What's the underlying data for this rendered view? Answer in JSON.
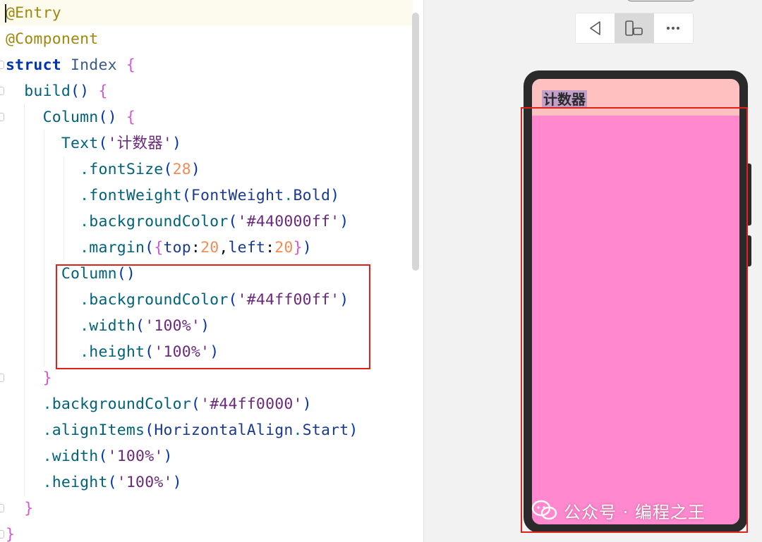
{
  "editor": {
    "lines": [
      [
        {
          "t": "@Entry",
          "c": "t-ann"
        }
      ],
      [
        {
          "t": "@Component",
          "c": "t-ann"
        }
      ],
      [
        {
          "t": "struct",
          "c": "t-kw"
        },
        {
          "t": " Index ",
          "c": "t-struct"
        },
        {
          "t": "{",
          "c": "t-brace"
        }
      ],
      [
        {
          "t": "  build",
          "c": "t-call"
        },
        {
          "t": "()",
          "c": "t-paren"
        },
        {
          "t": " {",
          "c": "t-brace"
        }
      ],
      [
        {
          "t": "    Column",
          "c": "t-call"
        },
        {
          "t": "()",
          "c": "t-paren"
        },
        {
          "t": " {",
          "c": "t-brace"
        }
      ],
      [
        {
          "t": "      Text",
          "c": "t-call"
        },
        {
          "t": "(",
          "c": "t-paren"
        },
        {
          "t": "'计数器'",
          "c": "t-strp"
        },
        {
          "t": ")",
          "c": "t-paren"
        }
      ],
      [
        {
          "t": "        .",
          "c": "t-dot"
        },
        {
          "t": "fontSize",
          "c": "t-meth"
        },
        {
          "t": "(",
          "c": "t-paren"
        },
        {
          "t": "28",
          "c": "t-num"
        },
        {
          "t": ")",
          "c": "t-paren"
        }
      ],
      [
        {
          "t": "        .",
          "c": "t-dot"
        },
        {
          "t": "fontWeight",
          "c": "t-meth"
        },
        {
          "t": "(",
          "c": "t-paren"
        },
        {
          "t": "FontWeight",
          "c": "t-kind"
        },
        {
          "t": ".",
          "c": "t-dot"
        },
        {
          "t": "Bold",
          "c": "t-kind"
        },
        {
          "t": ")",
          "c": "t-paren"
        }
      ],
      [
        {
          "t": "        .",
          "c": "t-dot"
        },
        {
          "t": "backgroundColor",
          "c": "t-meth"
        },
        {
          "t": "(",
          "c": "t-paren"
        },
        {
          "t": "'#440000ff'",
          "c": "t-strp"
        },
        {
          "t": ")",
          "c": "t-paren"
        }
      ],
      [
        {
          "t": "        .",
          "c": "t-dot"
        },
        {
          "t": "margin",
          "c": "t-meth"
        },
        {
          "t": "(",
          "c": "t-paren"
        },
        {
          "t": "{",
          "c": "t-brace"
        },
        {
          "t": "top",
          "c": "t-kind"
        },
        {
          "t": ":",
          "c": "t-plain"
        },
        {
          "t": "20",
          "c": "t-num"
        },
        {
          "t": ",",
          "c": "t-plain"
        },
        {
          "t": "left",
          "c": "t-kind"
        },
        {
          "t": ":",
          "c": "t-plain"
        },
        {
          "t": "20",
          "c": "t-num"
        },
        {
          "t": "}",
          "c": "t-brace"
        },
        {
          "t": ")",
          "c": "t-paren"
        }
      ],
      [
        {
          "t": "      Column",
          "c": "t-call"
        },
        {
          "t": "()",
          "c": "t-paren"
        }
      ],
      [
        {
          "t": "        .",
          "c": "t-dot"
        },
        {
          "t": "backgroundColor",
          "c": "t-meth"
        },
        {
          "t": "(",
          "c": "t-paren"
        },
        {
          "t": "'#44ff00ff'",
          "c": "t-strp"
        },
        {
          "t": ")",
          "c": "t-paren"
        }
      ],
      [
        {
          "t": "        .",
          "c": "t-dot"
        },
        {
          "t": "width",
          "c": "t-meth"
        },
        {
          "t": "(",
          "c": "t-paren"
        },
        {
          "t": "'100%'",
          "c": "t-strp"
        },
        {
          "t": ")",
          "c": "t-paren"
        }
      ],
      [
        {
          "t": "        .",
          "c": "t-dot"
        },
        {
          "t": "height",
          "c": "t-meth"
        },
        {
          "t": "(",
          "c": "t-paren"
        },
        {
          "t": "'100%'",
          "c": "t-strp"
        },
        {
          "t": ")",
          "c": "t-paren"
        }
      ],
      [
        {
          "t": "    }",
          "c": "t-brace"
        }
      ],
      [
        {
          "t": "    .",
          "c": "t-dot"
        },
        {
          "t": "backgroundColor",
          "c": "t-meth"
        },
        {
          "t": "(",
          "c": "t-paren"
        },
        {
          "t": "'#44ff0000'",
          "c": "t-strp"
        },
        {
          "t": ")",
          "c": "t-paren"
        }
      ],
      [
        {
          "t": "    .",
          "c": "t-dot"
        },
        {
          "t": "alignItems",
          "c": "t-meth"
        },
        {
          "t": "(",
          "c": "t-paren"
        },
        {
          "t": "HorizontalAlign",
          "c": "t-kind"
        },
        {
          "t": ".",
          "c": "t-dot"
        },
        {
          "t": "Start",
          "c": "t-kind"
        },
        {
          "t": ")",
          "c": "t-paren"
        }
      ],
      [
        {
          "t": "    .",
          "c": "t-dot"
        },
        {
          "t": "width",
          "c": "t-meth"
        },
        {
          "t": "(",
          "c": "t-paren"
        },
        {
          "t": "'100%'",
          "c": "t-strp"
        },
        {
          "t": ")",
          "c": "t-paren"
        }
      ],
      [
        {
          "t": "    .",
          "c": "t-dot"
        },
        {
          "t": "height",
          "c": "t-meth"
        },
        {
          "t": "(",
          "c": "t-paren"
        },
        {
          "t": "'100%'",
          "c": "t-strp"
        },
        {
          "t": ")",
          "c": "t-paren"
        }
      ],
      [
        {
          "t": "  }",
          "c": "t-brace"
        }
      ],
      [
        {
          "t": "}",
          "c": "t-brace"
        }
      ]
    ]
  },
  "previewer": {
    "toolbar": {
      "back_icon": "back-triangle-icon",
      "device_icon": "device-rotate-icon",
      "more_icon": "more-dots-icon"
    },
    "screen_text": "计数器"
  },
  "watermark": {
    "text": "公众号 · 编程之王",
    "icon": "wechat-icon"
  },
  "colors": {
    "highlight": "#e0201a",
    "screen_outer_bg": "#ffc0c0",
    "inner_column_bg": "#ff88ce",
    "text_bg": "#c2a0c8"
  }
}
